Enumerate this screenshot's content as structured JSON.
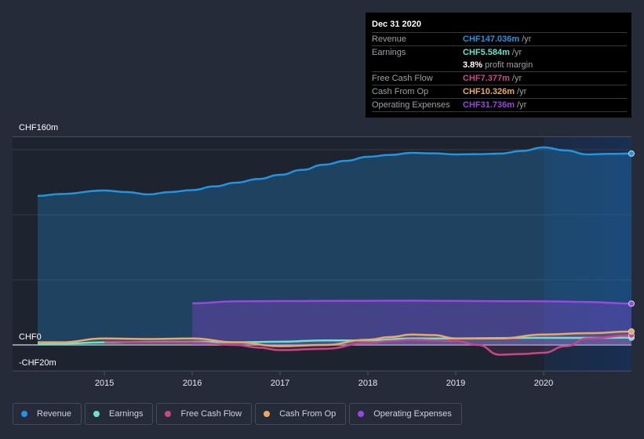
{
  "chart_data": {
    "type": "area",
    "title": "",
    "xlabel": "",
    "ylabel": "",
    "currency_unit": "CHF millions",
    "xlim": [
      2014.24,
      2021.0
    ],
    "ylim": [
      -20,
      160
    ],
    "y_ticks": [
      {
        "value": 160,
        "label": "CHF160m"
      },
      {
        "value": 0,
        "label": "CHF0"
      },
      {
        "value": -20,
        "label": "-CHF20m"
      }
    ],
    "y_gridlines": [
      150,
      100,
      50,
      0
    ],
    "x_ticks": [
      {
        "value": 2015,
        "label": "2015"
      },
      {
        "value": 2016,
        "label": "2016"
      },
      {
        "value": 2017,
        "label": "2017"
      },
      {
        "value": 2018,
        "label": "2018"
      },
      {
        "value": 2019,
        "label": "2019"
      },
      {
        "value": 2020,
        "label": "2020"
      }
    ],
    "highlight_start": 2020.0,
    "legend_position": "bottom",
    "series": [
      {
        "name": "Revenue",
        "color": "#2394df",
        "x": [
          2014.24,
          2014.5,
          2015.0,
          2015.25,
          2015.5,
          2015.75,
          2016.0,
          2016.25,
          2016.5,
          2016.75,
          2017.0,
          2017.25,
          2017.5,
          2017.75,
          2018.0,
          2018.25,
          2018.5,
          2018.75,
          2019.0,
          2019.25,
          2019.5,
          2019.75,
          2020.0,
          2020.25,
          2020.5,
          2020.75,
          2021.0
        ],
        "values": [
          114.5,
          116,
          118.7,
          117.5,
          115.7,
          117.5,
          119,
          121.8,
          124.7,
          127.5,
          130.7,
          134.5,
          138.5,
          141.5,
          144.6,
          146,
          147.6,
          147.2,
          146.4,
          146.6,
          147,
          149,
          151.8,
          149.5,
          146.4,
          146.8,
          147.036
        ]
      },
      {
        "name": "Earnings",
        "color": "#6ee0cc",
        "x": [
          2014.24,
          2014.5,
          2015.0,
          2015.5,
          2016.0,
          2016.5,
          2017.0,
          2017.5,
          2018.0,
          2018.5,
          2019.0,
          2019.5,
          2020.0,
          2020.5,
          2021.0
        ],
        "values": [
          0.5,
          1.0,
          2.0,
          2.3,
          2.5,
          2.0,
          2.5,
          3.5,
          3.5,
          5.0,
          5.0,
          5.3,
          5.5,
          5.4,
          5.584
        ]
      },
      {
        "name": "Free Cash Flow",
        "color": "#c7478b",
        "x": [
          2015.0,
          2015.5,
          2016.0,
          2016.5,
          2016.75,
          2017.0,
          2017.5,
          2018.0,
          2018.25,
          2018.5,
          2019.0,
          2019.25,
          2019.5,
          2019.75,
          2020.0,
          2020.25,
          2020.5,
          2021.0
        ],
        "values": [
          2.5,
          2.0,
          2.0,
          0.0,
          -2.0,
          -4.0,
          -3.0,
          1.5,
          3.0,
          4.0,
          3.0,
          0.0,
          -7.5,
          -7.0,
          -6.0,
          -1.0,
          5.0,
          7.377
        ]
      },
      {
        "name": "Cash From Op",
        "color": "#e9a863",
        "x": [
          2014.24,
          2014.5,
          2015.0,
          2015.5,
          2016.0,
          2016.5,
          2017.0,
          2017.5,
          2018.0,
          2018.25,
          2018.5,
          2018.75,
          2019.0,
          2019.5,
          2020.0,
          2020.5,
          2021.0
        ],
        "values": [
          2.0,
          2.0,
          5.0,
          4.5,
          5.0,
          2.0,
          -1.0,
          0.0,
          4.0,
          6.0,
          8.0,
          7.5,
          5.0,
          5.0,
          8.0,
          9.0,
          10.326
        ]
      },
      {
        "name": "Operating Expenses",
        "color": "#9b45e4",
        "x": [
          2016.0,
          2016.5,
          2017.0,
          2017.5,
          2018.0,
          2018.5,
          2019.0,
          2019.5,
          2020.0,
          2020.5,
          2021.0
        ],
        "values": [
          32.0,
          33.5,
          33.7,
          33.8,
          33.9,
          34.0,
          33.8,
          33.6,
          33.5,
          33.0,
          31.736
        ]
      }
    ]
  },
  "tooltip": {
    "date": "Dec 31 2020",
    "rows": [
      {
        "label": "Revenue",
        "value": "CHF147.036m",
        "unit": "/yr",
        "color": "#2394df"
      },
      {
        "label": "Earnings",
        "value": "CHF5.584m",
        "unit": "/yr",
        "color": "#6ee0cc"
      },
      {
        "label": "",
        "value": "3.8%",
        "unit": "profit margin",
        "color": "#ffffff"
      },
      {
        "label": "Free Cash Flow",
        "value": "CHF7.377m",
        "unit": "/yr",
        "color": "#c7478b"
      },
      {
        "label": "Cash From Op",
        "value": "CHF10.326m",
        "unit": "/yr",
        "color": "#e9a863"
      },
      {
        "label": "Operating Expenses",
        "value": "CHF31.736m",
        "unit": "/yr",
        "color": "#9b45e4"
      }
    ]
  },
  "legend": [
    {
      "label": "Revenue",
      "color": "#2394df"
    },
    {
      "label": "Earnings",
      "color": "#6ee0cc"
    },
    {
      "label": "Free Cash Flow",
      "color": "#c7478b"
    },
    {
      "label": "Cash From Op",
      "color": "#e9a863"
    },
    {
      "label": "Operating Expenses",
      "color": "#9b45e4"
    }
  ]
}
